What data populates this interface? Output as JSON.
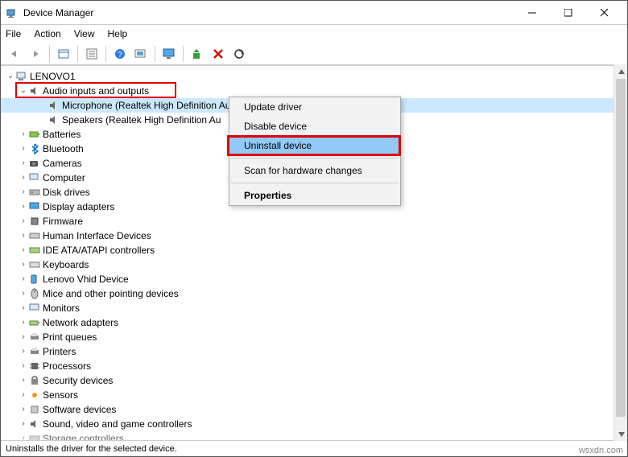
{
  "title": "Device Manager",
  "menu": {
    "file": "File",
    "action": "Action",
    "view": "View",
    "help": "Help"
  },
  "toolbar_icons": [
    "back",
    "forward",
    "show-hidden",
    "properties",
    "help",
    "scan",
    "monitor",
    "update",
    "delete",
    "refresh"
  ],
  "root_node": "LENOVO1",
  "audio_category": "Audio inputs and outputs",
  "audio_children": {
    "mic": "Microphone (Realtek High Definition Audio)",
    "speakers": "Speakers (Realtek High Definition Au"
  },
  "categories": [
    "Batteries",
    "Bluetooth",
    "Cameras",
    "Computer",
    "Disk drives",
    "Display adapters",
    "Firmware",
    "Human Interface Devices",
    "IDE ATA/ATAPI controllers",
    "Keyboards",
    "Lenovo Vhid Device",
    "Mice and other pointing devices",
    "Monitors",
    "Network adapters",
    "Print queues",
    "Printers",
    "Processors",
    "Security devices",
    "Sensors",
    "Software devices",
    "Sound, video and game controllers",
    "Storage controllers"
  ],
  "context_menu": {
    "update": "Update driver",
    "disable": "Disable device",
    "uninstall": "Uninstall device",
    "scan": "Scan for hardware changes",
    "properties": "Properties"
  },
  "statusbar": "Uninstalls the driver for the selected device.",
  "watermark": "wsxdn.com"
}
